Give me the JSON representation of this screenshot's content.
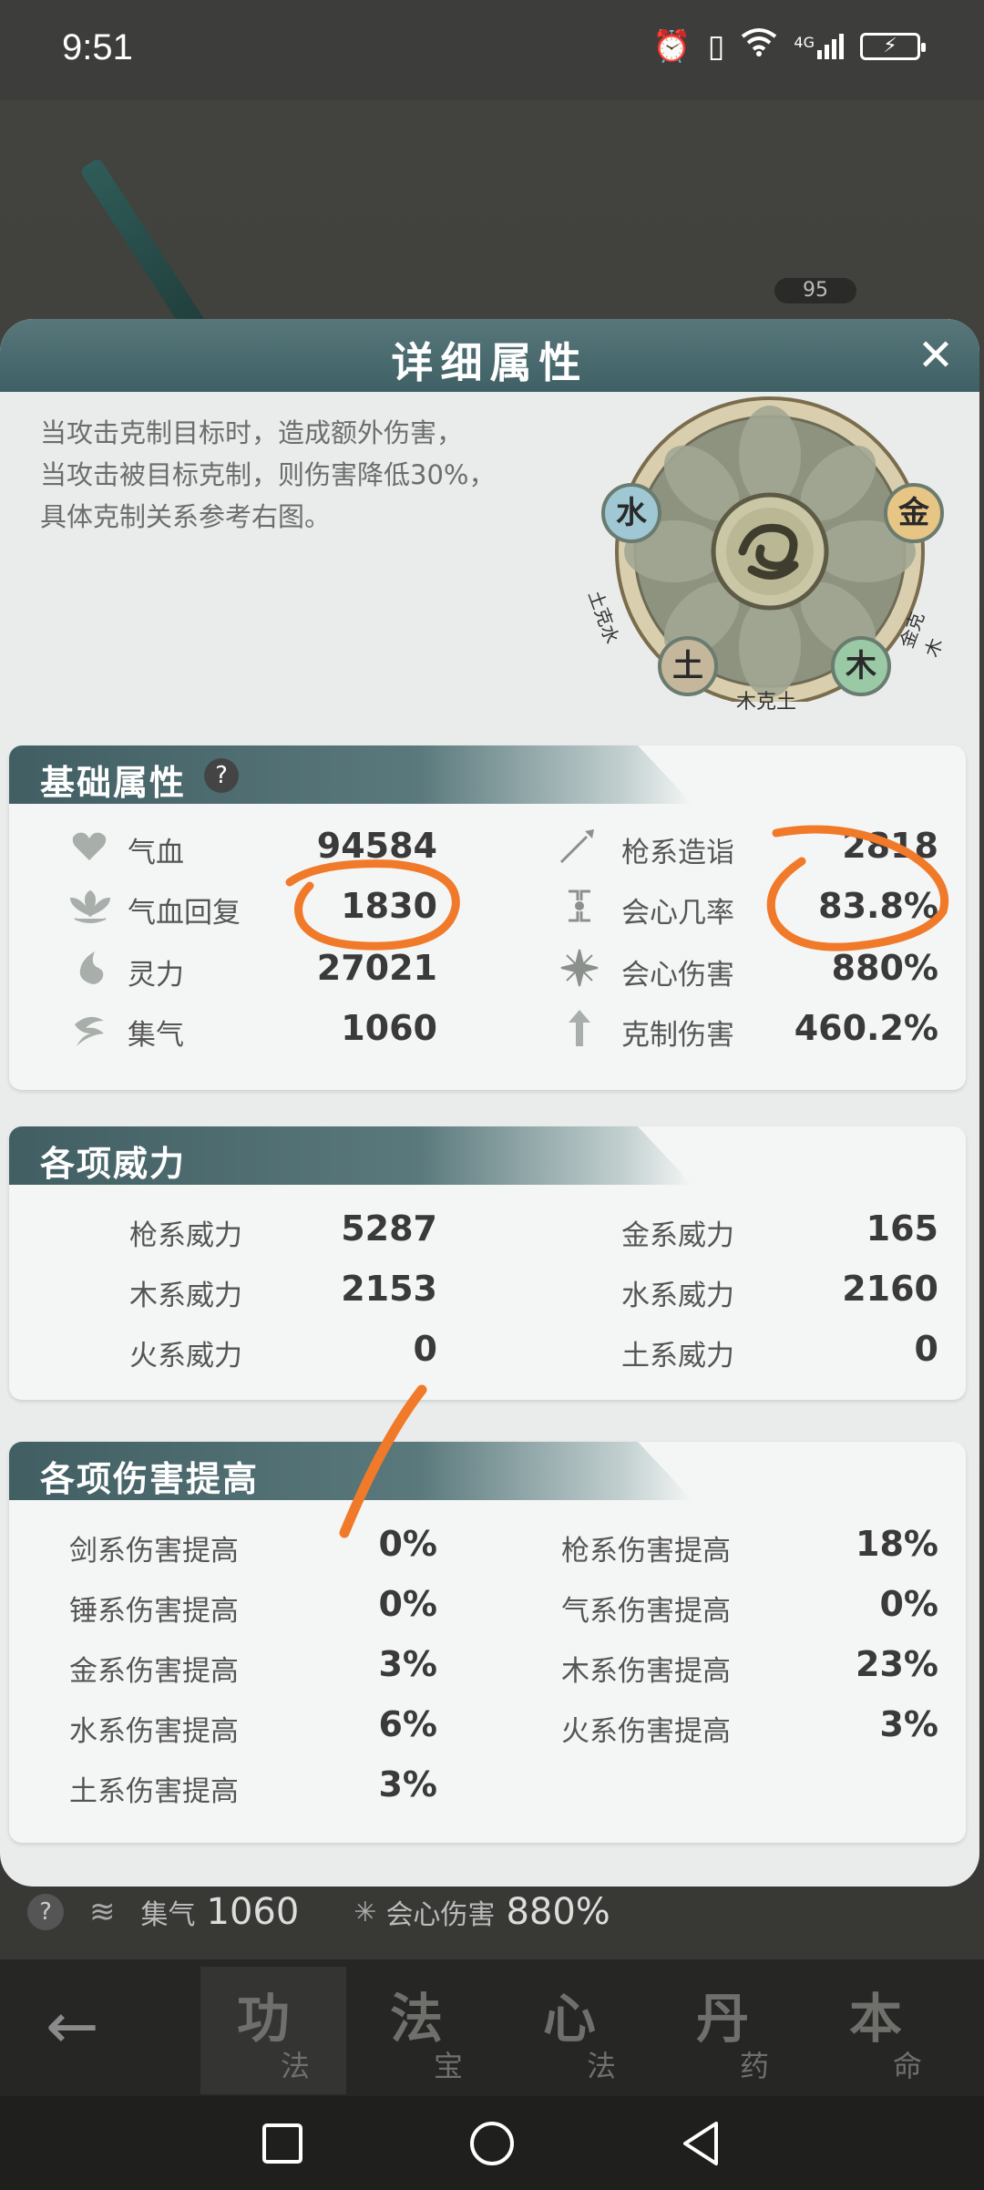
{
  "status_bar": {
    "time": "9:51",
    "network": "4G"
  },
  "background": {
    "level_badge": "95",
    "bottom_row": {
      "jiqi_label": "集气",
      "jiqi_value": "1060",
      "crit_dmg_label": "会心伤害",
      "crit_dmg_value": "880%"
    }
  },
  "panel": {
    "title": "详细属性",
    "description": [
      "当攻击克制目标时，造成额外伤害，",
      "当攻击被目标克制，则伤害降低30%，",
      "具体克制关系参考右图。"
    ],
    "wheel": {
      "water": "水",
      "metal": "金",
      "earth": "土",
      "wood": "木",
      "earth_beats_water": "土克水",
      "metal_beats_wood": "金克木",
      "wood_beats_earth": "木克土"
    },
    "basic": {
      "title": "基础属性",
      "help": "?",
      "rows": [
        {
          "label": "气血",
          "value": "94584",
          "icon": "heart-icon"
        },
        {
          "label": "气血回复",
          "value": "1830",
          "icon": "lotus-icon"
        },
        {
          "label": "灵力",
          "value": "27021",
          "icon": "flame-icon"
        },
        {
          "label": "集气",
          "value": "1060",
          "icon": "swirl-icon"
        }
      ],
      "rows_right": [
        {
          "label": "枪系造诣",
          "value": "2818",
          "icon": "spear-icon"
        },
        {
          "label": "会心几率",
          "value": "83.8%",
          "icon": "crit-icon"
        },
        {
          "label": "会心伤害",
          "value": "880%",
          "icon": "burst-icon"
        },
        {
          "label": "克制伤害",
          "value": "460.2%",
          "icon": "arrow-up-icon"
        }
      ]
    },
    "power": {
      "title": "各项威力",
      "left": [
        {
          "label": "枪系威力",
          "value": "5287"
        },
        {
          "label": "木系威力",
          "value": "2153"
        },
        {
          "label": "火系威力",
          "value": "0"
        }
      ],
      "right": [
        {
          "label": "金系威力",
          "value": "165"
        },
        {
          "label": "水系威力",
          "value": "2160"
        },
        {
          "label": "土系威力",
          "value": "0"
        }
      ]
    },
    "damage": {
      "title": "各项伤害提高",
      "left": [
        {
          "label": "剑系伤害提高",
          "value": "0%"
        },
        {
          "label": "锤系伤害提高",
          "value": "0%"
        },
        {
          "label": "金系伤害提高",
          "value": "3%"
        },
        {
          "label": "水系伤害提高",
          "value": "6%"
        },
        {
          "label": "土系伤害提高",
          "value": "3%"
        }
      ],
      "right": [
        {
          "label": "枪系伤害提高",
          "value": "18%"
        },
        {
          "label": "气系伤害提高",
          "value": "0%"
        },
        {
          "label": "木系伤害提高",
          "value": "23%"
        },
        {
          "label": "火系伤害提高",
          "value": "3%"
        }
      ]
    }
  },
  "game_tabs": [
    {
      "big": "功",
      "small": "法"
    },
    {
      "big": "法",
      "small": "宝"
    },
    {
      "big": "心",
      "small": "法"
    },
    {
      "big": "丹",
      "small": "药"
    },
    {
      "big": "本",
      "small": "命"
    }
  ],
  "colors": {
    "header": "#4a6a6e",
    "panel": "#e9ecea",
    "annotation": "#f07a2a"
  }
}
